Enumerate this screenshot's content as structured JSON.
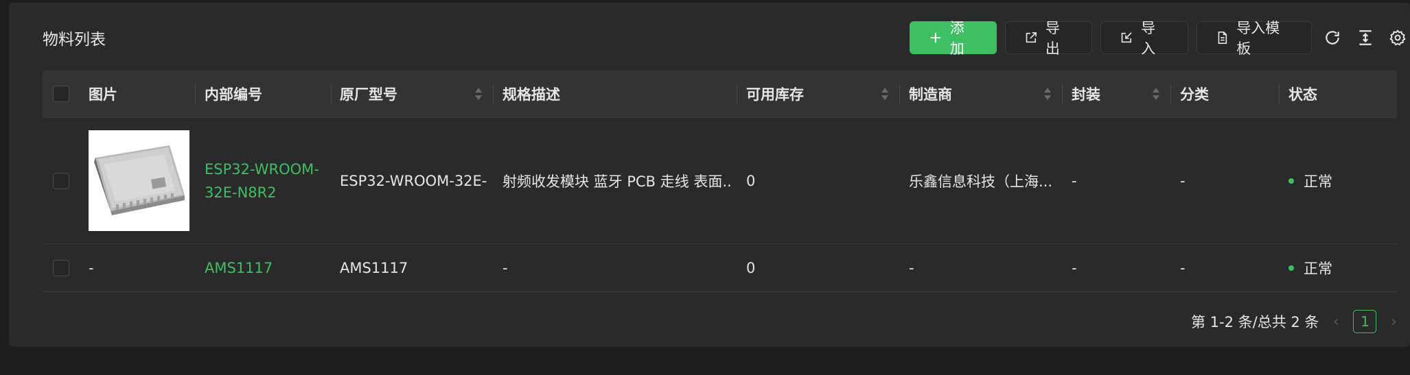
{
  "card": {
    "title": "物料列表"
  },
  "toolbar": {
    "add_label": "添加",
    "export_label": "导出",
    "import_label": "导入",
    "import_template_label": "导入模板"
  },
  "table": {
    "columns": {
      "image": "图片",
      "internal_no": "内部编号",
      "mfr_part": "原厂型号",
      "spec": "规格描述",
      "stock": "可用库存",
      "manufacturer": "制造商",
      "package": "封装",
      "category": "分类",
      "status": "状态"
    },
    "rows": [
      {
        "image": "",
        "internal_no": "ESP32-WROOM-32E-N8R2",
        "mfr_part": "ESP32-WROOM-32E-...",
        "spec": "射频收发模块 蓝牙 PCB 走线 表面...",
        "stock": "0",
        "manufacturer": "乐鑫信息科技（上海...",
        "package": "-",
        "category": "-",
        "status": "正常"
      },
      {
        "image": "-",
        "internal_no": "AMS1117",
        "mfr_part": "AMS1117",
        "spec": "-",
        "stock": "0",
        "manufacturer": "-",
        "package": "-",
        "category": "-",
        "status": "正常"
      }
    ]
  },
  "pagination": {
    "summary": "第 1-2 条/总共 2 条",
    "current_page": "1"
  },
  "colors": {
    "accent": "#3fbf63",
    "background": "#1e1e1e",
    "card": "#2a2a2a",
    "header": "#333333"
  }
}
